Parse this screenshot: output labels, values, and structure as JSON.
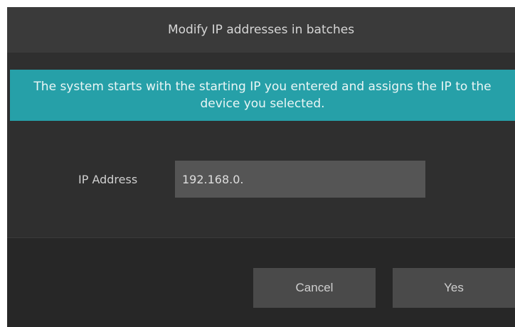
{
  "dialog": {
    "title": "Modify IP addresses in batches",
    "info": "The system starts with the starting IP you entered and assigns the IP to the device you selected.",
    "ip_label": "IP Address",
    "ip_value": "192.168.0.",
    "cancel_label": "Cancel",
    "yes_label": "Yes"
  }
}
